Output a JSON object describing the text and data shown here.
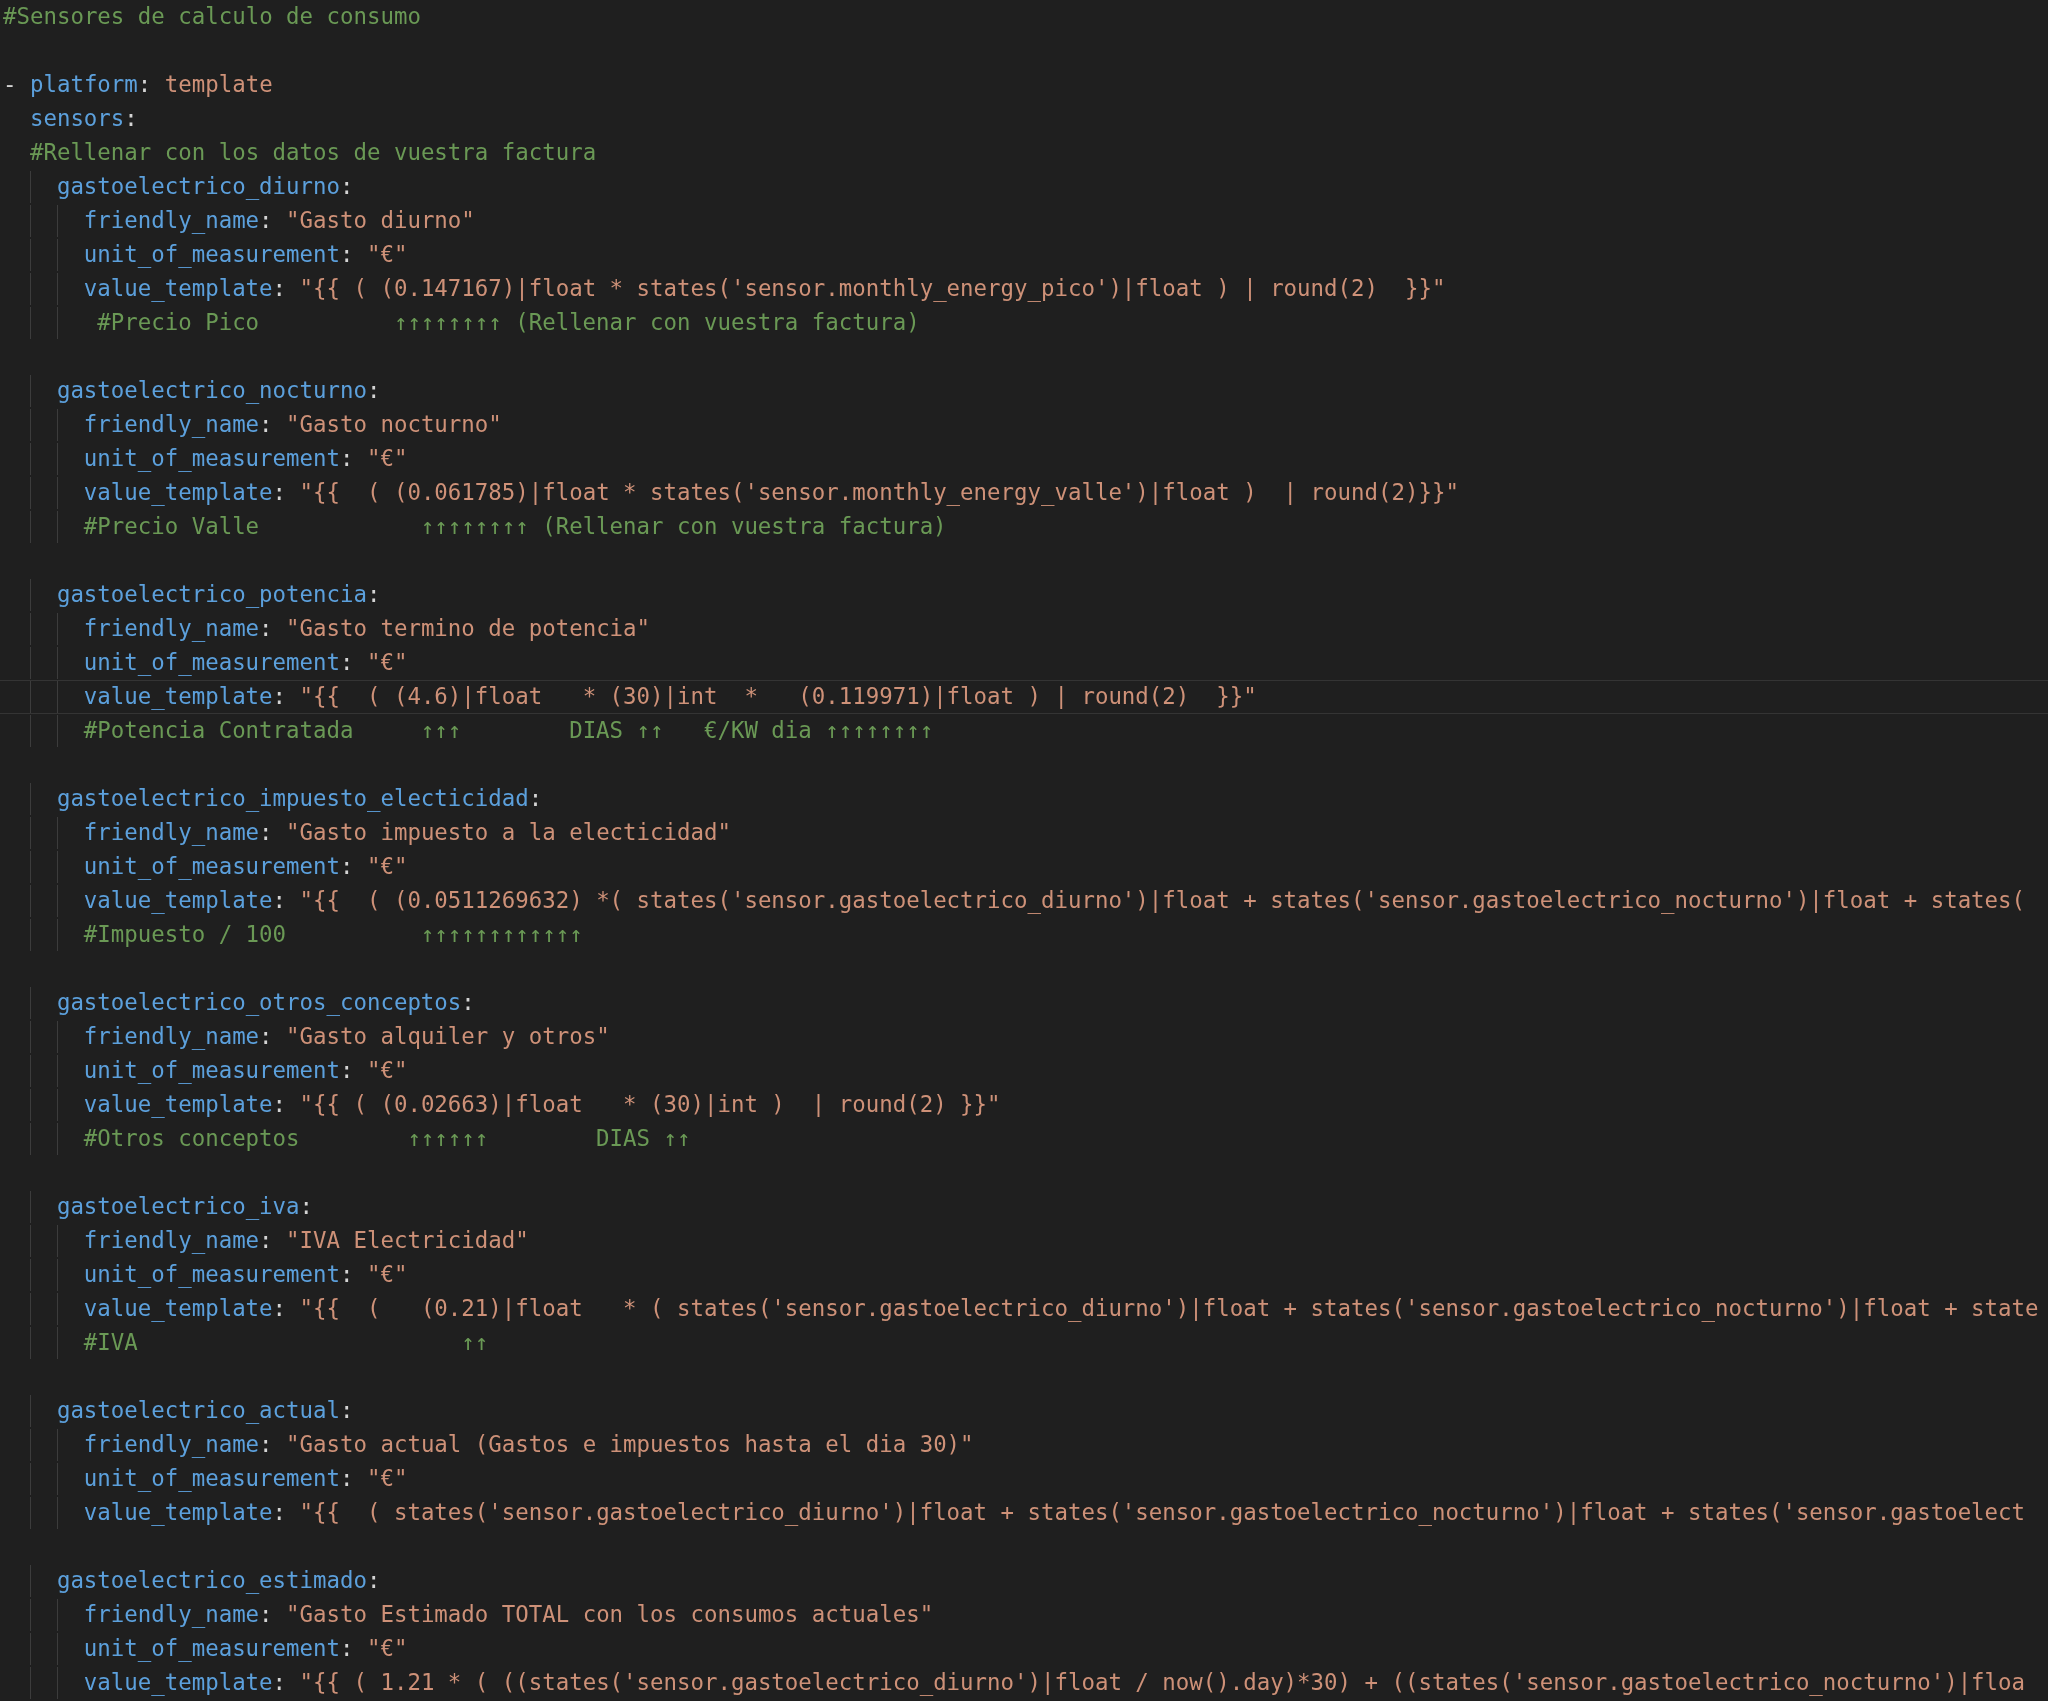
{
  "editor": {
    "lines": [
      {
        "current": false,
        "tokens": [
          {
            "kind": "comment",
            "text": "#Sensores de calculo de consumo"
          }
        ]
      },
      {
        "current": false
      },
      {
        "current": false,
        "tokens": [
          {
            "kind": "punct",
            "text": "- "
          },
          {
            "kind": "key",
            "text": "platform"
          },
          {
            "kind": "punct",
            "text": ": "
          },
          {
            "kind": "string",
            "text": "template"
          }
        ]
      },
      {
        "current": false,
        "tokens": [
          {
            "kind": "key",
            "text": "  sensors"
          },
          {
            "kind": "punct",
            "text": ":"
          }
        ]
      },
      {
        "current": false,
        "tokens": [
          {
            "kind": "comment",
            "text": "  #Rellenar con los datos de vuestra factura"
          }
        ]
      },
      {
        "current": false,
        "tokens": [
          {
            "kind": "key",
            "text": "    gastoelectrico_diurno"
          },
          {
            "kind": "punct",
            "text": ":"
          }
        ]
      },
      {
        "current": false,
        "tokens": [
          {
            "kind": "key",
            "text": "      friendly_name"
          },
          {
            "kind": "punct",
            "text": ": "
          },
          {
            "kind": "string",
            "text": "\"Gasto diurno\""
          }
        ]
      },
      {
        "current": false,
        "tokens": [
          {
            "kind": "key",
            "text": "      unit_of_measurement"
          },
          {
            "kind": "punct",
            "text": ": "
          },
          {
            "kind": "string",
            "text": "\"€\""
          }
        ]
      },
      {
        "current": false,
        "tokens": [
          {
            "kind": "key",
            "text": "      value_template"
          },
          {
            "kind": "punct",
            "text": ": "
          },
          {
            "kind": "string",
            "text": "\"{{ ( (0.147167)|float * states('sensor.monthly_energy_pico')|float ) | round(2)  }}\""
          }
        ]
      },
      {
        "current": false,
        "tokens": [
          {
            "kind": "comment",
            "text": "       #Precio Pico          ↑↑↑↑↑↑↑↑ (Rellenar con vuestra factura)"
          }
        ]
      },
      {
        "current": false
      },
      {
        "current": false,
        "tokens": [
          {
            "kind": "key",
            "text": "    gastoelectrico_nocturno"
          },
          {
            "kind": "punct",
            "text": ":"
          }
        ]
      },
      {
        "current": false,
        "tokens": [
          {
            "kind": "key",
            "text": "      friendly_name"
          },
          {
            "kind": "punct",
            "text": ": "
          },
          {
            "kind": "string",
            "text": "\"Gasto nocturno\""
          }
        ]
      },
      {
        "current": false,
        "tokens": [
          {
            "kind": "key",
            "text": "      unit_of_measurement"
          },
          {
            "kind": "punct",
            "text": ": "
          },
          {
            "kind": "string",
            "text": "\"€\""
          }
        ]
      },
      {
        "current": false,
        "tokens": [
          {
            "kind": "key",
            "text": "      value_template"
          },
          {
            "kind": "punct",
            "text": ": "
          },
          {
            "kind": "string",
            "text": "\"{{  ( (0.061785)|float * states('sensor.monthly_energy_valle')|float )  | round(2)}}\""
          }
        ]
      },
      {
        "current": false,
        "tokens": [
          {
            "kind": "comment",
            "text": "      #Precio Valle            ↑↑↑↑↑↑↑↑ (Rellenar con vuestra factura)"
          }
        ]
      },
      {
        "current": false
      },
      {
        "current": false,
        "tokens": [
          {
            "kind": "key",
            "text": "    gastoelectrico_potencia"
          },
          {
            "kind": "punct",
            "text": ":"
          }
        ]
      },
      {
        "current": false,
        "tokens": [
          {
            "kind": "key",
            "text": "      friendly_name"
          },
          {
            "kind": "punct",
            "text": ": "
          },
          {
            "kind": "string",
            "text": "\"Gasto termino de potencia\""
          }
        ]
      },
      {
        "current": false,
        "tokens": [
          {
            "kind": "key",
            "text": "      unit_of_measurement"
          },
          {
            "kind": "punct",
            "text": ": "
          },
          {
            "kind": "string",
            "text": "\"€\""
          }
        ]
      },
      {
        "current": true,
        "tokens": [
          {
            "kind": "key",
            "text": "      value_template"
          },
          {
            "kind": "punct",
            "text": ": "
          },
          {
            "kind": "string",
            "text": "\"{{  ( (4.6)|float   * (30)|int  *   (0.119971)|float ) | round(2)  }}\""
          }
        ]
      },
      {
        "current": false,
        "tokens": [
          {
            "kind": "comment",
            "text": "      #Potencia Contratada     ↑↑↑        DIAS ↑↑   €/KW dia ↑↑↑↑↑↑↑↑"
          }
        ]
      },
      {
        "current": false
      },
      {
        "current": false,
        "tokens": [
          {
            "kind": "key",
            "text": "    gastoelectrico_impuesto_electicidad"
          },
          {
            "kind": "punct",
            "text": ":"
          }
        ]
      },
      {
        "current": false,
        "tokens": [
          {
            "kind": "key",
            "text": "      friendly_name"
          },
          {
            "kind": "punct",
            "text": ": "
          },
          {
            "kind": "string",
            "text": "\"Gasto impuesto a la electicidad\""
          }
        ]
      },
      {
        "current": false,
        "tokens": [
          {
            "kind": "key",
            "text": "      unit_of_measurement"
          },
          {
            "kind": "punct",
            "text": ": "
          },
          {
            "kind": "string",
            "text": "\"€\""
          }
        ]
      },
      {
        "current": false,
        "tokens": [
          {
            "kind": "key",
            "text": "      value_template"
          },
          {
            "kind": "punct",
            "text": ": "
          },
          {
            "kind": "string",
            "text": "\"{{  ( (0.0511269632) *( states('sensor.gastoelectrico_diurno')|float + states('sensor.gastoelectrico_nocturno')|float + states("
          }
        ]
      },
      {
        "current": false,
        "tokens": [
          {
            "kind": "comment",
            "text": "      #Impuesto / 100          ↑↑↑↑↑↑↑↑↑↑↑↑"
          }
        ]
      },
      {
        "current": false
      },
      {
        "current": false,
        "tokens": [
          {
            "kind": "key",
            "text": "    gastoelectrico_otros_conceptos"
          },
          {
            "kind": "punct",
            "text": ":"
          }
        ]
      },
      {
        "current": false,
        "tokens": [
          {
            "kind": "key",
            "text": "      friendly_name"
          },
          {
            "kind": "punct",
            "text": ": "
          },
          {
            "kind": "string",
            "text": "\"Gasto alquiler y otros\""
          }
        ]
      },
      {
        "current": false,
        "tokens": [
          {
            "kind": "key",
            "text": "      unit_of_measurement"
          },
          {
            "kind": "punct",
            "text": ": "
          },
          {
            "kind": "string",
            "text": "\"€\""
          }
        ]
      },
      {
        "current": false,
        "tokens": [
          {
            "kind": "key",
            "text": "      value_template"
          },
          {
            "kind": "punct",
            "text": ": "
          },
          {
            "kind": "string",
            "text": "\"{{ ( (0.02663)|float   * (30)|int )  | round(2) }}\""
          }
        ]
      },
      {
        "current": false,
        "tokens": [
          {
            "kind": "comment",
            "text": "      #Otros conceptos        ↑↑↑↑↑↑        DIAS ↑↑"
          }
        ]
      },
      {
        "current": false
      },
      {
        "current": false,
        "tokens": [
          {
            "kind": "key",
            "text": "    gastoelectrico_iva"
          },
          {
            "kind": "punct",
            "text": ":"
          }
        ]
      },
      {
        "current": false,
        "tokens": [
          {
            "kind": "key",
            "text": "      friendly_name"
          },
          {
            "kind": "punct",
            "text": ": "
          },
          {
            "kind": "string",
            "text": "\"IVA Electricidad\""
          }
        ]
      },
      {
        "current": false,
        "tokens": [
          {
            "kind": "key",
            "text": "      unit_of_measurement"
          },
          {
            "kind": "punct",
            "text": ": "
          },
          {
            "kind": "string",
            "text": "\"€\""
          }
        ]
      },
      {
        "current": false,
        "tokens": [
          {
            "kind": "key",
            "text": "      value_template"
          },
          {
            "kind": "punct",
            "text": ": "
          },
          {
            "kind": "string",
            "text": "\"{{  (   (0.21)|float   * ( states('sensor.gastoelectrico_diurno')|float + states('sensor.gastoelectrico_nocturno')|float + state"
          }
        ]
      },
      {
        "current": false,
        "tokens": [
          {
            "kind": "comment",
            "text": "      #IVA                        ↑↑"
          }
        ]
      },
      {
        "current": false
      },
      {
        "current": false,
        "tokens": [
          {
            "kind": "key",
            "text": "    gastoelectrico_actual"
          },
          {
            "kind": "punct",
            "text": ":"
          }
        ]
      },
      {
        "current": false,
        "tokens": [
          {
            "kind": "key",
            "text": "      friendly_name"
          },
          {
            "kind": "punct",
            "text": ": "
          },
          {
            "kind": "string",
            "text": "\"Gasto actual (Gastos e impuestos hasta el dia 30)\""
          }
        ]
      },
      {
        "current": false,
        "tokens": [
          {
            "kind": "key",
            "text": "      unit_of_measurement"
          },
          {
            "kind": "punct",
            "text": ": "
          },
          {
            "kind": "string",
            "text": "\"€\""
          }
        ]
      },
      {
        "current": false,
        "tokens": [
          {
            "kind": "key",
            "text": "      value_template"
          },
          {
            "kind": "punct",
            "text": ": "
          },
          {
            "kind": "string",
            "text": "\"{{  ( states('sensor.gastoelectrico_diurno')|float + states('sensor.gastoelectrico_nocturno')|float + states('sensor.gastoelect"
          }
        ]
      },
      {
        "current": false
      },
      {
        "current": false,
        "tokens": [
          {
            "kind": "key",
            "text": "    gastoelectrico_estimado"
          },
          {
            "kind": "punct",
            "text": ":"
          }
        ]
      },
      {
        "current": false,
        "tokens": [
          {
            "kind": "key",
            "text": "      friendly_name"
          },
          {
            "kind": "punct",
            "text": ": "
          },
          {
            "kind": "string",
            "text": "\"Gasto Estimado TOTAL con los consumos actuales\""
          }
        ]
      },
      {
        "current": false,
        "tokens": [
          {
            "kind": "key",
            "text": "      unit_of_measurement"
          },
          {
            "kind": "punct",
            "text": ": "
          },
          {
            "kind": "string",
            "text": "\"€\""
          }
        ]
      },
      {
        "current": false,
        "tokens": [
          {
            "kind": "key",
            "text": "      value_template"
          },
          {
            "kind": "punct",
            "text": ": "
          },
          {
            "kind": "string",
            "text": "\"{{ ( 1.21 * ( ((states('sensor.gastoelectrico_diurno')|float / now().day)*30) + ((states('sensor.gastoelectrico_nocturno')|floa"
          }
        ]
      }
    ]
  }
}
